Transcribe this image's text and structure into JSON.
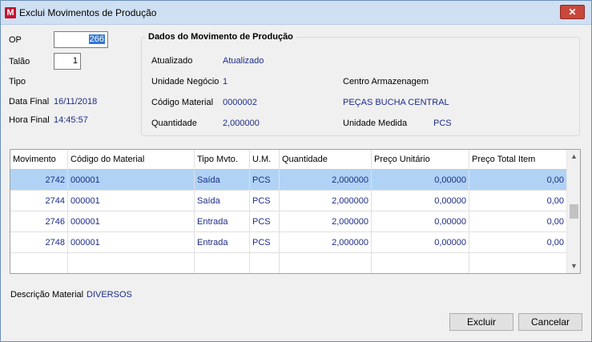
{
  "window": {
    "title": "Exclui Movimentos de Produção",
    "close_glyph": "✕"
  },
  "left": {
    "op_label": "OP",
    "op_value": "266",
    "talao_label": "Talão",
    "talao_value": "1",
    "tipo_label": "Tipo",
    "data_final_label": "Data Final",
    "data_final_value": "16/11/2018",
    "hora_final_label": "Hora Final",
    "hora_final_value": "14:45:57"
  },
  "group": {
    "title": "Dados do Movimento de Produção",
    "atualizado_label": "Atualizado",
    "atualizado_value": "Atualizado",
    "unidade_negocio_label": "Unidade Negócio",
    "unidade_negocio_value": "1",
    "centro_label": "Centro Armazenagem",
    "codigo_material_label": "Código Material",
    "codigo_material_value": "0000002",
    "material_desc_value": "PEÇAS BUCHA CENTRAL",
    "quantidade_label": "Quantidade",
    "quantidade_value": "2,000000",
    "unidade_medida_label": "Unidade Medida",
    "unidade_medida_value": "PCS"
  },
  "grid": {
    "columns": [
      "Movimento",
      "Código do Material",
      "Tipo Mvto.",
      "U.M.",
      "Quantidade",
      "Preço Unitário",
      "Preço Total Item"
    ],
    "rows": [
      [
        "2742",
        "000001",
        "Saída",
        "PCS",
        "2,000000",
        "0,00000",
        "0,00"
      ],
      [
        "2744",
        "000001",
        "Saída",
        "PCS",
        "2,000000",
        "0,00000",
        "0,00"
      ],
      [
        "2746",
        "000001",
        "Entrada",
        "PCS",
        "2,000000",
        "0,00000",
        "0,00"
      ],
      [
        "2748",
        "000001",
        "Entrada",
        "PCS",
        "2,000000",
        "0,00000",
        "0,00"
      ]
    ],
    "selected_row": 0
  },
  "footer": {
    "descricao_label": "Descrição Material",
    "descricao_value": "DIVERSOS",
    "excluir_label": "Excluir",
    "cancelar_label": "Cancelar"
  },
  "colors": {
    "value_text": "#1d2c8a",
    "selected_row": "#b0d3f5",
    "titlebar": "#cfe0f3",
    "close_button": "#c8493b"
  },
  "icons": {
    "app": "app-logo-icon",
    "close": "close-icon",
    "scroll_up": "chevron-up-icon",
    "scroll_down": "chevron-down-icon"
  }
}
